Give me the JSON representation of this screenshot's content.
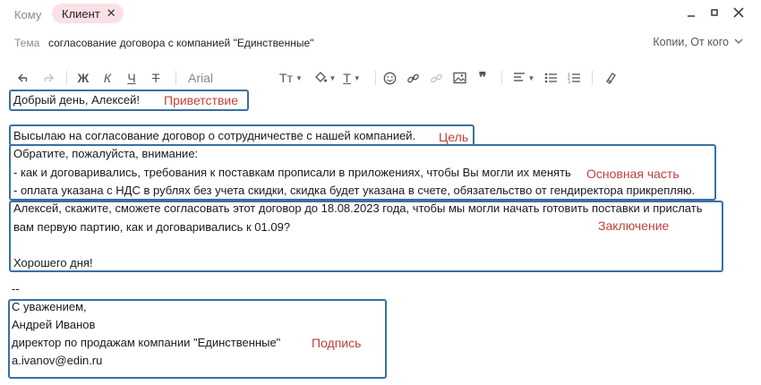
{
  "header": {
    "to_label": "Кому",
    "recipient": "Клиент",
    "subject_label": "Тема",
    "subject": "согласование договора с компанией \"Единственные\"",
    "copies_label": "Копии, От кого"
  },
  "toolbar": {
    "font": "Arial",
    "icons": [
      "undo-icon",
      "redo-icon",
      "bold",
      "italic",
      "underline",
      "strikethrough",
      "font-family",
      "text-size",
      "fill-color",
      "text-color",
      "emoji",
      "link",
      "unlink",
      "image",
      "quote",
      "align",
      "bulleted-list",
      "numbered-list",
      "clear-format"
    ],
    "bold": "Ж",
    "italic": "К",
    "underline": "Ч",
    "strike": "Т",
    "text_size": "Тт",
    "text_color": "Т",
    "quote": "❞"
  },
  "body": {
    "greeting": "Добрый день, Алексей!",
    "purpose": "Высылаю на согласование договор о сотрудничестве с нашей компанией.",
    "main_1": "Обратите, пожалуйста, внимание:",
    "main_2": "- как и договаривались, требования к поставкам прописали в приложениях, чтобы Вы могли их менять",
    "main_3": "- оплата указана с НДС в рублях без учета скидки, скидка будет указана в счете, обязательство от гендиректора прикрепляю.",
    "conclusion_1": "Алексей, скажите, сможете согласовать этот договор до 18.08.2023 года, чтобы мы могли начать готовить поставки и прислать",
    "conclusion_2": "вам первую партию, как и договаривались к 01.09?",
    "farewell": "Хорошего дня!",
    "separator": "--",
    "sig_1": "С уважением,",
    "sig_2": "Андрей Иванов",
    "sig_3": "директор по продажам компании \"Единственные\"",
    "sig_4": "a.ivanov@edin.ru"
  },
  "annotations": {
    "greeting": "Приветствие",
    "purpose": "Цель",
    "main": "Основная часть",
    "conclusion": "Заключение",
    "signature": "Подпись"
  },
  "colors": {
    "box_border": "#3b6fa3",
    "annotation_text": "#c2403b",
    "chip_bg": "#fbe0e6"
  }
}
